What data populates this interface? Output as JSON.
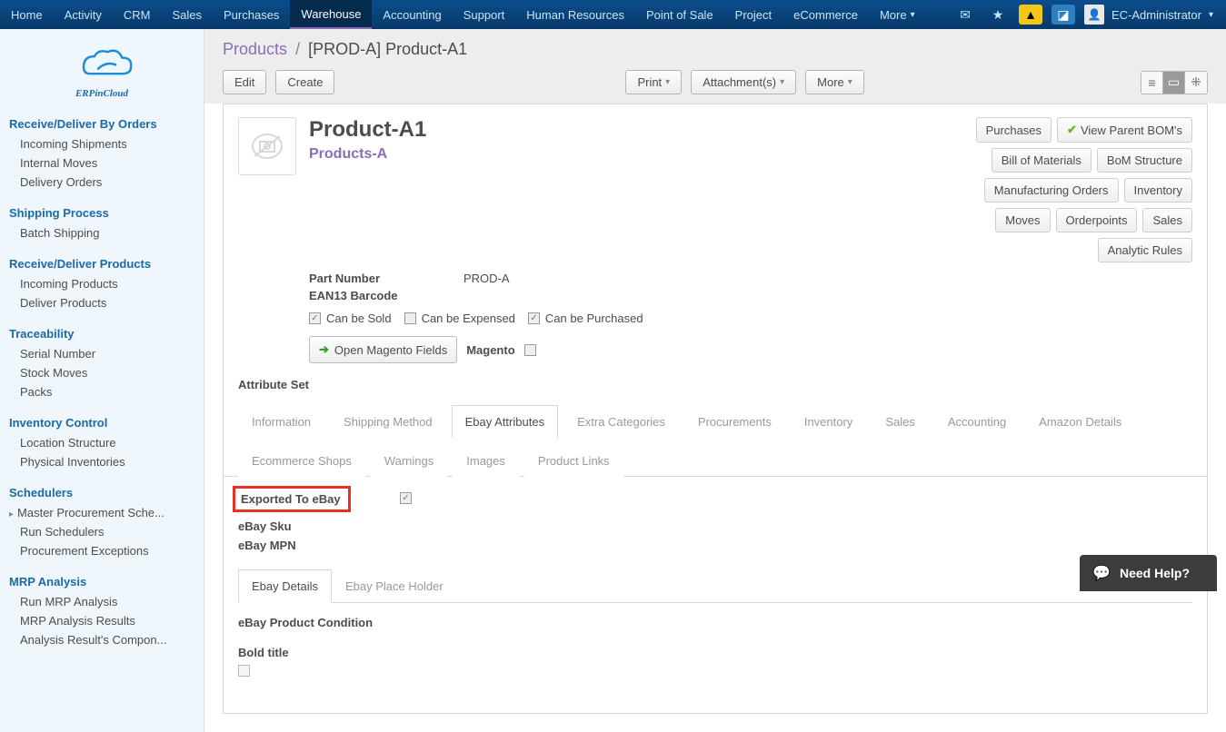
{
  "nav": {
    "items": [
      "Home",
      "Activity",
      "CRM",
      "Sales",
      "Purchases",
      "Warehouse",
      "Accounting",
      "Support",
      "Human Resources",
      "Point of Sale",
      "Project",
      "eCommerce"
    ],
    "more": "More",
    "active": "Warehouse",
    "user": "EC-Administrator"
  },
  "logo_text": "ERPinCloud",
  "sidebar": [
    {
      "title": "Receive/Deliver By Orders",
      "items": [
        "Incoming Shipments",
        "Internal Moves",
        "Delivery Orders"
      ]
    },
    {
      "title": "Shipping Process",
      "items": [
        "Batch Shipping"
      ]
    },
    {
      "title": "Receive/Deliver Products",
      "items": [
        "Incoming Products",
        "Deliver Products"
      ]
    },
    {
      "title": "Traceability",
      "items": [
        "Serial Number",
        "Stock Moves",
        "Packs"
      ]
    },
    {
      "title": "Inventory Control",
      "items": [
        "Location Structure",
        "Physical Inventories"
      ]
    },
    {
      "title": "Schedulers",
      "items": [
        "Master Procurement Sche...",
        "Run Schedulers",
        "Procurement Exceptions"
      ],
      "caret": [
        0
      ]
    },
    {
      "title": "MRP Analysis",
      "items": [
        "Run MRP Analysis",
        "MRP Analysis Results",
        "Analysis Result's Compon..."
      ]
    }
  ],
  "breadcrumb": {
    "parent": "Products",
    "sep": "/",
    "current": "[PROD-A] Product-A1"
  },
  "actions": {
    "edit": "Edit",
    "create": "Create",
    "print": "Print",
    "attachments": "Attachment(s)",
    "more": "More"
  },
  "product": {
    "name": "Product-A1",
    "category": "Products-A",
    "part_number_label": "Part Number",
    "part_number": "PROD-A",
    "ean_label": "EAN13 Barcode",
    "can_be_sold": "Can be Sold",
    "can_be_expensed": "Can be Expensed",
    "can_be_purchased": "Can be Purchased",
    "open_magento": "Open Magento Fields",
    "magento": "Magento",
    "attribute_set": "Attribute Set"
  },
  "side_buttons": {
    "purchases": "Purchases",
    "view_bom": "View Parent BOM's",
    "bill_of_materials": "Bill of Materials",
    "bom_structure": "BoM Structure",
    "mfg_orders": "Manufacturing Orders",
    "inventory": "Inventory",
    "moves": "Moves",
    "orderpoints": "Orderpoints",
    "sales": "Sales",
    "analytic": "Analytic Rules"
  },
  "tabs": [
    "Information",
    "Shipping Method",
    "Ebay Attributes",
    "Extra Categories",
    "Procurements",
    "Inventory",
    "Sales",
    "Accounting",
    "Amazon Details",
    "Ecommerce Shops",
    "Warnings",
    "Images",
    "Product Links"
  ],
  "tabs_active": "Ebay Attributes",
  "ebay": {
    "exported": "Exported To eBay",
    "sku": "eBay Sku",
    "mpn": "eBay MPN"
  },
  "subtabs": [
    "Ebay Details",
    "Ebay Place Holder"
  ],
  "subtabs_active": "Ebay Details",
  "details": {
    "condition": "eBay Product Condition",
    "bold": "Bold title"
  },
  "help": "Need Help?"
}
